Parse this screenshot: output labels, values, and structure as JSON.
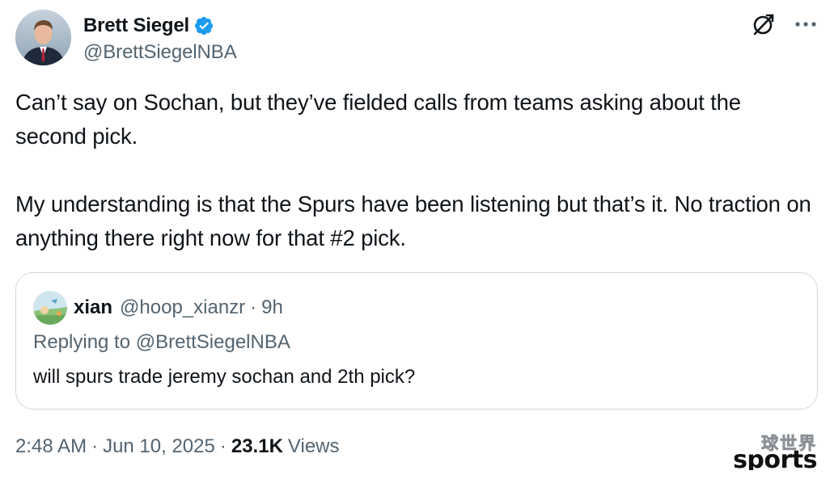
{
  "tweet": {
    "author": {
      "display_name": "Brett Siegel",
      "handle": "@BrettSiegelNBA",
      "verified": true
    },
    "paragraphs": [
      "Can’t say on Sochan, but they’ve fielded calls from teams asking about the second pick.",
      "My understanding is that the Spurs have been listening but that’s it. No traction on anything there right now for that #2 pick."
    ],
    "quoted": {
      "author_name": "xian",
      "handle": "@hoop_xianzr",
      "dot": "·",
      "time": "9h",
      "replying_to": "Replying to @BrettSiegelNBA",
      "text": "will spurs trade jeremy sochan and 2th pick?"
    },
    "meta": {
      "time": "2:48 AM",
      "date": "Jun 10, 2025",
      "separator": "·",
      "views_count": "23.1K",
      "views_label": "Views"
    }
  },
  "watermark": {
    "cn": "球世界",
    "en": "sports"
  },
  "colors": {
    "verified": "#1d9bf0",
    "text": "#0f1419",
    "secondary": "#536471",
    "border": "#cfd9de"
  },
  "icons": [
    "verified-badge-icon",
    "grok-icon",
    "more-icon"
  ]
}
